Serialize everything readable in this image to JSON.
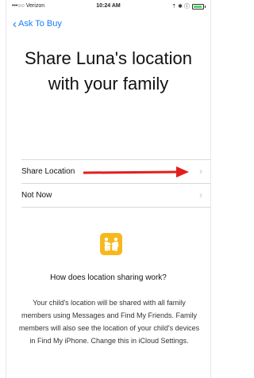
{
  "status_bar": {
    "carrier": "•••○○ Verizon",
    "time": "10:24 AM",
    "right_indicators": "⇡ ✱ ⓘ"
  },
  "nav": {
    "back_label": "Ask To Buy"
  },
  "title": "Share Luna's location with your family",
  "options": [
    {
      "label": "Share Location"
    },
    {
      "label": "Not Now"
    }
  ],
  "info": {
    "question": "How does location sharing work?",
    "description": "Your child's location will be shared with all family members using Messages and Find My Friends. Family members will also see the location of your child's devices in Find My iPhone. Change this in iCloud Settings."
  },
  "colors": {
    "accent": "#1a7cf5",
    "arrow": "#e0201e",
    "family_icon_bg": "#f6b81c",
    "battery": "#4cd964"
  },
  "icons": {
    "back": "chevron-left-icon",
    "row": "chevron-right-icon",
    "family": "family-sharing-icon"
  }
}
